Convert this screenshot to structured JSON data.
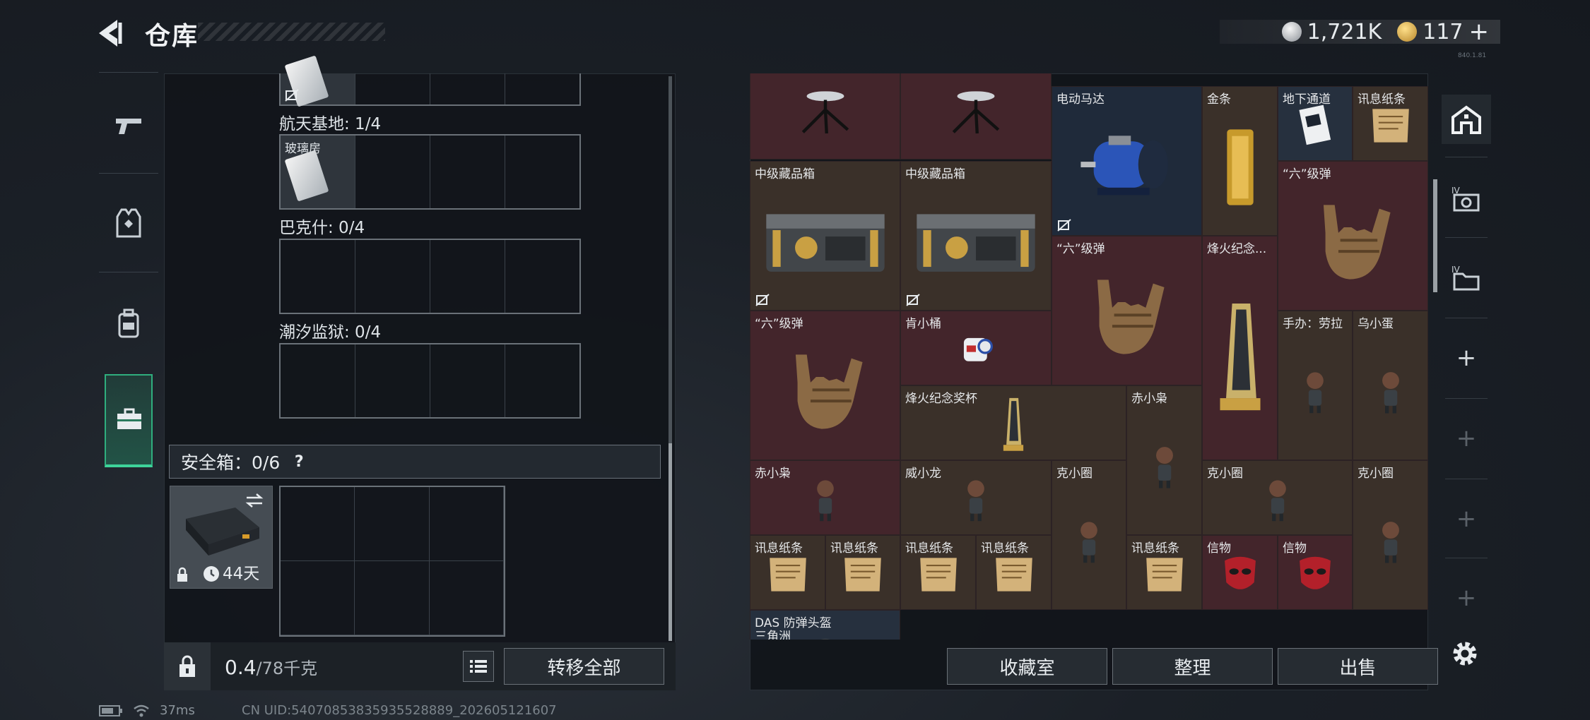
{
  "header": {
    "title": "仓库",
    "silver_amount": "1,721K",
    "gold_amount": "117",
    "gold_add_label": "+",
    "version": "840.1.81"
  },
  "left_tabs": [
    {
      "name": "weapons",
      "icon": "pistol-icon"
    },
    {
      "name": "gear",
      "icon": "vest-icon"
    },
    {
      "name": "backpack",
      "icon": "backpack-icon"
    },
    {
      "name": "toolbox",
      "icon": "briefcase-icon",
      "active": true
    }
  ],
  "middle": {
    "sections": [
      {
        "label": "航天基地: 1/4",
        "first_item": "玻璃房"
      },
      {
        "label": "巴克什: 0/4"
      },
      {
        "label": "潮汐监狱: 0/4"
      }
    ],
    "safebox": {
      "label": "安全箱：0/6",
      "help": "?",
      "timer": "44天"
    },
    "weight": {
      "current": "0.4",
      "capacity": "/78千克"
    },
    "transfer_label": "转移全部"
  },
  "inventory": {
    "items": [
      {
        "label": "",
        "kind": "tripod"
      },
      {
        "label": "",
        "kind": "tripod"
      },
      {
        "label": "电动马达",
        "kind": "motor"
      },
      {
        "label": "金条",
        "kind": "goldbar"
      },
      {
        "label": "地下通道",
        "kind": "card"
      },
      {
        "label": "讯息纸条",
        "kind": "paper"
      },
      {
        "label": "中级藏品箱",
        "kind": "chest"
      },
      {
        "label": "中级藏品箱",
        "kind": "chest"
      },
      {
        "label": "“六”级弹",
        "kind": "hand"
      },
      {
        "label": "“六”级弹",
        "kind": "hand"
      },
      {
        "label": "烽火纪念...",
        "kind": "trophy"
      },
      {
        "label": "“六”级弹",
        "kind": "hand"
      },
      {
        "label": "肯小桶",
        "kind": "bucket"
      },
      {
        "label": "手办：劳拉",
        "kind": "figure"
      },
      {
        "label": "乌小蛋",
        "kind": "figure"
      },
      {
        "label": "烽火纪念奖杯",
        "kind": "trophy"
      },
      {
        "label": "赤小枭",
        "kind": "figure"
      },
      {
        "label": "赤小枭",
        "kind": "figure"
      },
      {
        "label": "威小龙",
        "kind": "figure"
      },
      {
        "label": "克小圈",
        "kind": "figure"
      },
      {
        "label": "克小圈",
        "kind": "figure"
      },
      {
        "label": "克小圈",
        "kind": "figure"
      },
      {
        "label": "讯息纸条",
        "kind": "paper"
      },
      {
        "label": "讯息纸条",
        "kind": "paper"
      },
      {
        "label": "讯息纸条",
        "kind": "paper"
      },
      {
        "label": "讯息纸条",
        "kind": "paper"
      },
      {
        "label": "讯息纸条",
        "kind": "paper"
      },
      {
        "label": "信物",
        "kind": "mask"
      },
      {
        "label": "信物",
        "kind": "mask"
      },
      {
        "label": "DAS 防弹头盔",
        "kind": "helmet"
      }
    ],
    "partial_label": "三角洲"
  },
  "right_tabs": [
    "home-icon",
    "iv-card-icon",
    "iv-folder-icon",
    "+",
    "+",
    "+",
    "+"
  ],
  "buttons": {
    "collection": "收藏室",
    "organize": "整理",
    "sell": "出售"
  },
  "footer": {
    "ping": "37ms",
    "uid": "CN UID:54070853835935528889_202605121607"
  },
  "colors": {
    "accent_green": "#3ed39a",
    "item_red": "#43252b",
    "item_brown": "#3a3029",
    "item_blue": "#1f2a3a"
  }
}
